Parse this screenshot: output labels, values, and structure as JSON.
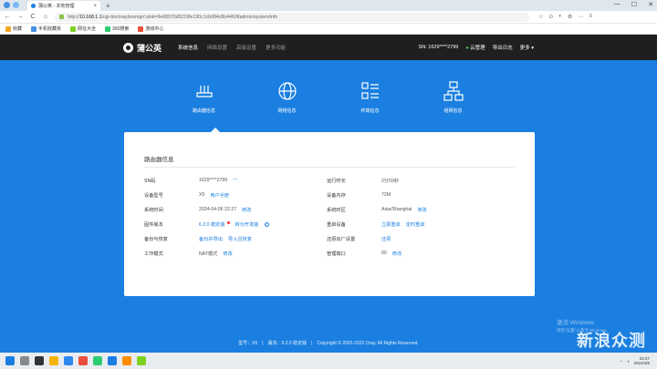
{
  "browser": {
    "tab_title": "蒲公英 - 本地管理",
    "tab_close": "×",
    "new_tab": "+",
    "address_prefix": "http://",
    "address_host": "10.168.1.1",
    "address_path": "/cgi-bin/orayboxmgr/;stok=9e68970d5219fe130c1cb084c8b4460f/admin/system/info",
    "nav_back": "←",
    "nav_forward": "→",
    "nav_reload": "C",
    "nav_home": "⌂",
    "win_min": "—",
    "win_max": "☐",
    "win_close": "✕",
    "menu_btn": "≡",
    "tb_icons": [
      "☆",
      "⊙",
      "◐",
      "⚙",
      "⋯"
    ],
    "bookmarks": [
      {
        "label": "收藏",
        "color": "#f5a623"
      },
      {
        "label": "手机收藏夹",
        "color": "#4a90e2"
      },
      {
        "label": "网址大全",
        "color": "#7ed321"
      },
      {
        "label": "360搜索",
        "color": "#2ecc71"
      },
      {
        "label": "游戏中心",
        "color": "#e94e3c"
      }
    ]
  },
  "router": {
    "brand": "蒲公英",
    "menu": [
      "系统信息",
      "网络设置",
      "高级设置",
      "更多功能"
    ],
    "sn_label": "SN: 1629****2799",
    "cloud": "云管理",
    "export_log": "导出日志",
    "more": "更多 ▾"
  },
  "nav_icons": [
    {
      "label": "路由器信息"
    },
    {
      "label": "网络信息"
    },
    {
      "label": "终端信息"
    },
    {
      "label": "组网信息"
    }
  ],
  "panel": {
    "title": "路由器信息",
    "left": [
      {
        "key": "SN码",
        "value": "1629****2799",
        "action": "﹀"
      },
      {
        "key": "设备型号",
        "value": "X5",
        "action": "用户手册"
      },
      {
        "key": "系统时间",
        "value": "2024-04-06 22:27",
        "action": "修改"
      },
      {
        "key": "固件版本",
        "value": "6.2.0 稳定版",
        "action": "转为开发版"
      },
      {
        "key": "备份与恢复",
        "value": "",
        "action": "备份并导出",
        "action2": "导入且恢复"
      },
      {
        "key": "工作模式",
        "value": "NAT模式",
        "action": "修改"
      }
    ],
    "right": [
      {
        "key": "运行时长",
        "value": "2分59秒",
        "action": ""
      },
      {
        "key": "设备内存",
        "value": "72M",
        "action": ""
      },
      {
        "key": "系统时区",
        "value": "Asia/Shanghai",
        "action": "修改"
      },
      {
        "key": "重启设备",
        "value": "",
        "action": "立即重启",
        "action2": "定时重启"
      },
      {
        "key": "还原出厂设置",
        "value": "",
        "action": "还原"
      },
      {
        "key": "管理端口",
        "value": "80",
        "action": "修改"
      }
    ]
  },
  "footer": "型号：X5　|　版本：6.2.0 稳定版　|　Copyright © 2002-2022 Oray. All Rights Reserved.",
  "watermark": {
    "line1": "激活 Windows",
    "line2": "转到\"设置\"以激活 Windows。"
  },
  "corner_logo": "新浪众测",
  "clock": {
    "time": "22:27",
    "date": "2024/4/6"
  },
  "colors": {
    "accent": "#1a7fe0",
    "dark_bar": "#1f1f1f",
    "cloud_green": "#4cd964"
  }
}
